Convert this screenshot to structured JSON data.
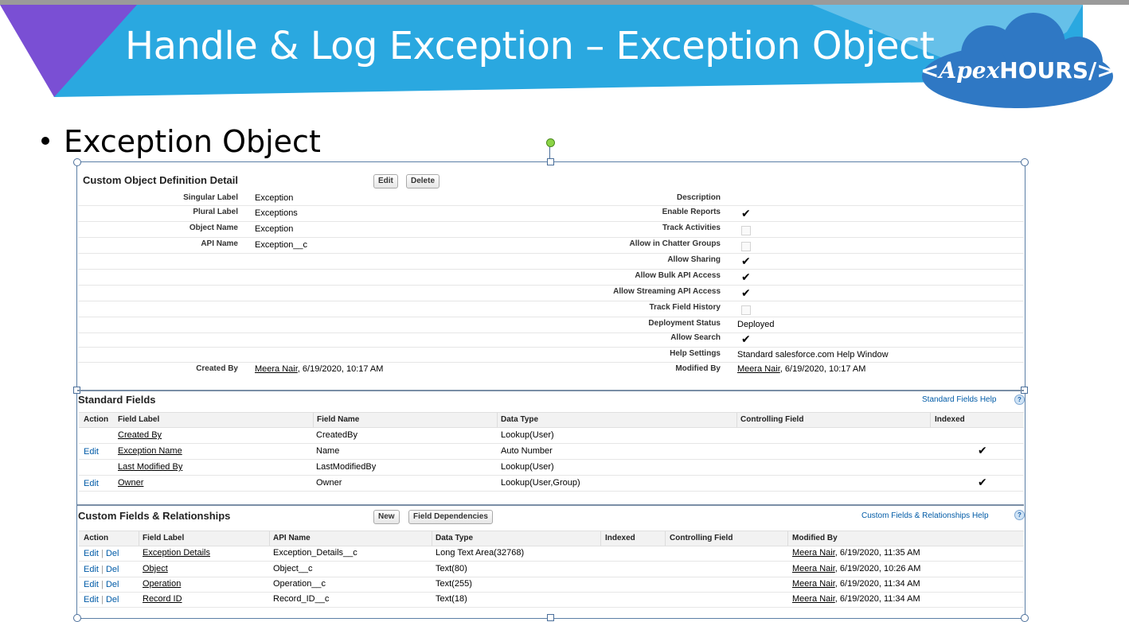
{
  "slide": {
    "title": "Handle & Log Exception – Exception Object",
    "logo_left": "<",
    "logo_apex": "Apex",
    "logo_hours": "HOURS",
    "logo_right": "/>",
    "bullet": "Exception Object",
    "colors": {
      "banner": "#2aa8e0",
      "triangle": "#7a4fd4",
      "logo_cloud": "#2f78c4"
    }
  },
  "detail": {
    "title": "Custom Object Definition Detail",
    "edit_label": "Edit",
    "delete_label": "Delete",
    "left": {
      "singular_label": {
        "label": "Singular Label",
        "value": "Exception"
      },
      "plural_label": {
        "label": "Plural Label",
        "value": "Exceptions"
      },
      "object_name": {
        "label": "Object Name",
        "value": "Exception"
      },
      "api_name": {
        "label": "API Name",
        "value": "Exception__c"
      },
      "created_by": {
        "label": "Created By",
        "user": "Meera Nair",
        "date": ", 6/19/2020, 10:17 AM"
      }
    },
    "right": {
      "description": {
        "label": "Description"
      },
      "enable_reports": {
        "label": "Enable Reports",
        "checked": true
      },
      "track_activities": {
        "label": "Track Activities",
        "checked": false
      },
      "allow_chatter": {
        "label": "Allow in Chatter Groups",
        "checked": false
      },
      "allow_sharing": {
        "label": "Allow Sharing",
        "checked": true
      },
      "allow_bulk": {
        "label": "Allow Bulk API Access",
        "checked": true
      },
      "allow_streaming": {
        "label": "Allow Streaming API Access",
        "checked": true
      },
      "track_history": {
        "label": "Track Field History",
        "checked": false
      },
      "deployment_status": {
        "label": "Deployment Status",
        "value": "Deployed"
      },
      "allow_search": {
        "label": "Allow Search",
        "checked": true
      },
      "help_settings": {
        "label": "Help Settings",
        "value": "Standard salesforce.com Help Window"
      },
      "modified_by": {
        "label": "Modified By",
        "user": "Meera Nair",
        "date": ", 6/19/2020, 10:17 AM"
      }
    }
  },
  "check_glyph": "✔",
  "standard_fields": {
    "title": "Standard Fields",
    "help_label": "Standard Fields Help",
    "help_icon": "?",
    "headers": [
      "Action",
      "Field Label",
      "Field Name",
      "Data Type",
      "Controlling Field",
      "Indexed"
    ],
    "rows": [
      {
        "action": "",
        "label": "Created By",
        "name": "CreatedBy",
        "type": "Lookup(User)",
        "indexed": false
      },
      {
        "action": "Edit",
        "label": "Exception Name",
        "name": "Name",
        "type": "Auto Number",
        "indexed": true
      },
      {
        "action": "",
        "label": "Last Modified By",
        "name": "LastModifiedBy",
        "type": "Lookup(User)",
        "indexed": false
      },
      {
        "action": "Edit",
        "label": "Owner",
        "name": "Owner",
        "type": "Lookup(User,Group)",
        "indexed": true
      }
    ]
  },
  "custom_fields": {
    "title": "Custom Fields & Relationships",
    "new_label": "New",
    "deps_label": "Field Dependencies",
    "help_label": "Custom Fields & Relationships Help",
    "help_icon": "?",
    "edit_label": "Edit",
    "sep": "|",
    "del_label": "Del",
    "headers": [
      "Action",
      "Field Label",
      "API Name",
      "Data Type",
      "Indexed",
      "Controlling Field",
      "Modified By"
    ],
    "rows": [
      {
        "label": "Exception Details",
        "api": "Exception_Details__c",
        "type": "Long Text Area(32768)",
        "user": "Meera Nair",
        "date": ", 6/19/2020, 11:35 AM"
      },
      {
        "label": "Object",
        "api": "Object__c",
        "type": "Text(80)",
        "user": "Meera Nair",
        "date": ", 6/19/2020, 10:26 AM"
      },
      {
        "label": "Operation",
        "api": "Operation__c",
        "type": "Text(255)",
        "user": "Meera Nair",
        "date": ", 6/19/2020, 11:34 AM"
      },
      {
        "label": "Record ID",
        "api": "Record_ID__c",
        "type": "Text(18)",
        "user": "Meera Nair",
        "date": ", 6/19/2020, 11:34 AM"
      }
    ]
  }
}
